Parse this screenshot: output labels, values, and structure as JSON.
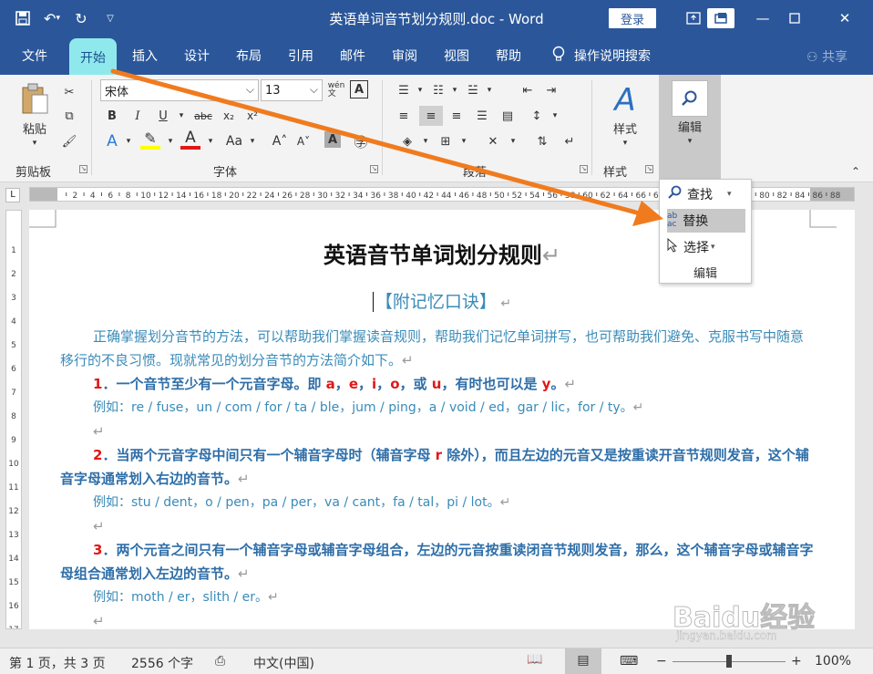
{
  "window": {
    "title": "英语单词音节划分规则.doc - Word",
    "login_label": "登录"
  },
  "menu": {
    "tabs": [
      "文件",
      "开始",
      "插入",
      "设计",
      "布局",
      "引用",
      "邮件",
      "审阅",
      "视图",
      "帮助"
    ],
    "search_label": "操作说明搜索",
    "share_label": "共享"
  },
  "ribbon": {
    "clipboard_label": "剪贴板",
    "paste_label": "粘贴",
    "font_label": "字体",
    "font_name": "宋体",
    "font_size": "13",
    "paragraph_label": "段落",
    "styles_label": "样式",
    "style_button": "样式",
    "edit_button": "编辑"
  },
  "edit_popup": {
    "find": "查找",
    "replace": "替换",
    "select": "选择",
    "group_label": "编辑"
  },
  "document": {
    "heading": "英语音节单词划分规则",
    "subheading": "【附记忆口诀】",
    "intro": "正确掌握划分音节的方法，可以帮助我们掌握读音规则，帮助我们记忆单词拼写，也可帮助我们避免、克服书写中随意移行的不良习惯。现就常见的划分音节的方法简介如下。",
    "rule1_a": "1．一个音节至少有一个元音字母。即 ",
    "rule1_letters": [
      "a",
      "e",
      "i",
      "o",
      "u",
      "y"
    ],
    "rule1_b": "，有时也可以是 ",
    "rule1_or": "或 ",
    "example1": "例如：re / fuse，un / com / for / ta / ble，jum / ping，a / void / ed，gar / lic，for / ty。",
    "rule2_num": "2",
    "rule2_a": "．当两个元音字母中间只有一个辅音字母时（辅音字母 ",
    "rule2_r": "r",
    "rule2_b": " 除外），而且左边的元音又是按重读开音节规则发音，这个辅音字母通常划入右边的音节。",
    "example2": "例如：stu / dent，o / pen，pa / per，va / cant，fa / tal，pi / lot。",
    "rule3_num": "3",
    "rule3_a": "．两个元音之间只有一个辅音字母或辅音字母组合，左边的元音按重读闭音节规则发音，那么，这个辅音字母或辅音字母组合通常划入左边的音节。",
    "example3": "例如：moth / er，slith / er。"
  },
  "status": {
    "page": "第 1 页，共 3 页",
    "words": "2556 个字",
    "language": "中文(中国)",
    "zoom": "100%"
  },
  "watermark": {
    "brand": "Baidu经验",
    "url": "jingyan.baidu.com"
  },
  "colors": {
    "title_bar": "#2b579a",
    "home_tab_highlight": "#8fe9ec",
    "doc_text": "#3a8bb8",
    "accent_red": "#e01818",
    "arrow": "#f07b1e"
  }
}
